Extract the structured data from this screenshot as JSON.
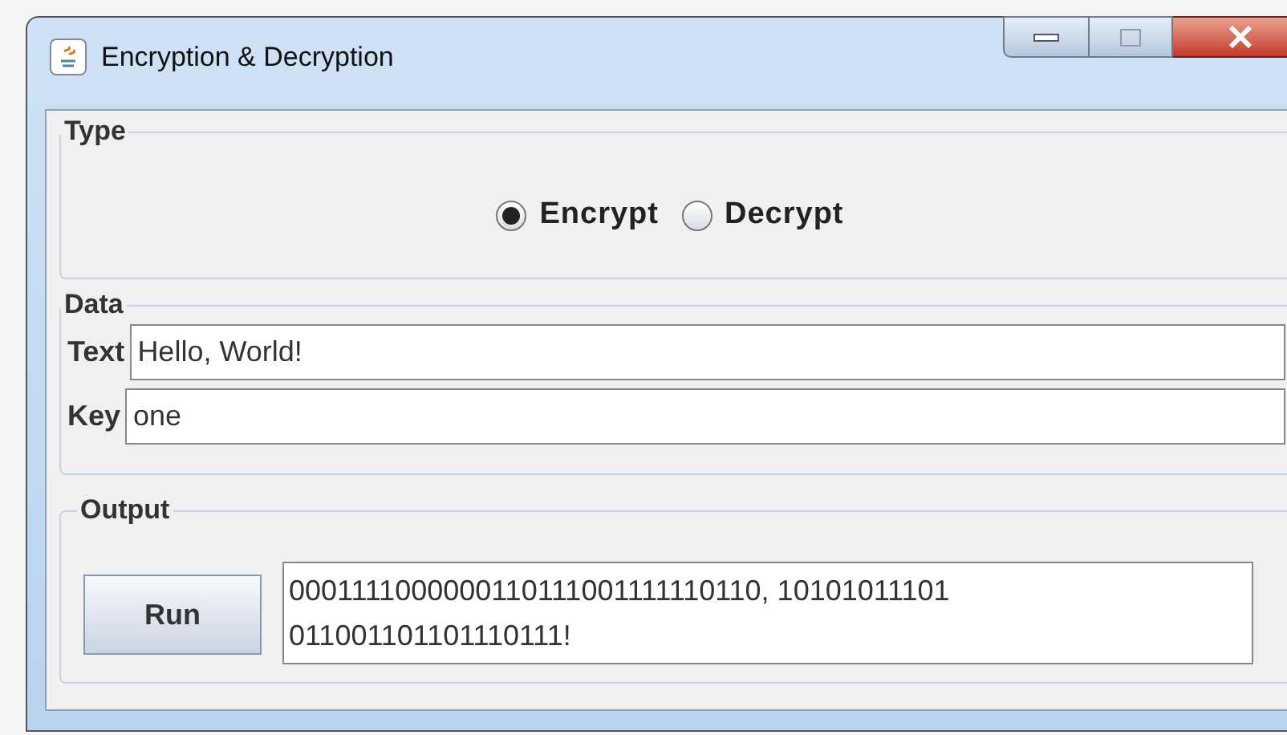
{
  "window": {
    "title": "Encryption & Decryption"
  },
  "type": {
    "legend": "Type",
    "options": [
      {
        "label": "Encrypt",
        "selected": true
      },
      {
        "label": "Decrypt",
        "selected": false
      }
    ]
  },
  "data": {
    "legend": "Data",
    "fields": [
      {
        "label": "Text",
        "value": "Hello, World!"
      },
      {
        "label": "Key",
        "value": "one"
      }
    ]
  },
  "output": {
    "legend": "Output",
    "button": "Run",
    "lines": [
      "0001111000000110111001111110110, 10101011101",
      "011001101101110111!"
    ]
  }
}
